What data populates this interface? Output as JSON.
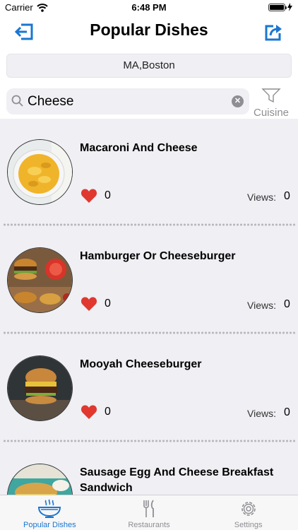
{
  "status_bar": {
    "carrier": "Carrier",
    "time": "6:48 PM"
  },
  "nav": {
    "title": "Popular Dishes",
    "logout_icon": "logout-icon",
    "share_icon": "share-icon",
    "accent_color": "#1a76d2"
  },
  "location": {
    "text": "MA,Boston"
  },
  "search": {
    "value": "Cheese",
    "placeholder": ""
  },
  "filter": {
    "label": "Cuisine"
  },
  "dishes": [
    {
      "name": "Macaroni And Cheese",
      "likes": "0",
      "views_label": "Views:",
      "views": "0"
    },
    {
      "name": "Hamburger Or Cheeseburger",
      "likes": "0",
      "views_label": "Views:",
      "views": "0"
    },
    {
      "name": "Mooyah Cheeseburger",
      "likes": "0",
      "views_label": "Views:",
      "views": "0"
    },
    {
      "name": "Sausage Egg And Cheese Breakfast Sandwich",
      "likes": "",
      "views_label": "",
      "views": ""
    }
  ],
  "tabs": [
    {
      "label": "Popular Dishes",
      "icon": "bowl-icon",
      "active": true
    },
    {
      "label": "Restaurants",
      "icon": "fork-knife-icon",
      "active": false
    },
    {
      "label": "Settings",
      "icon": "gear-icon",
      "active": false
    }
  ]
}
